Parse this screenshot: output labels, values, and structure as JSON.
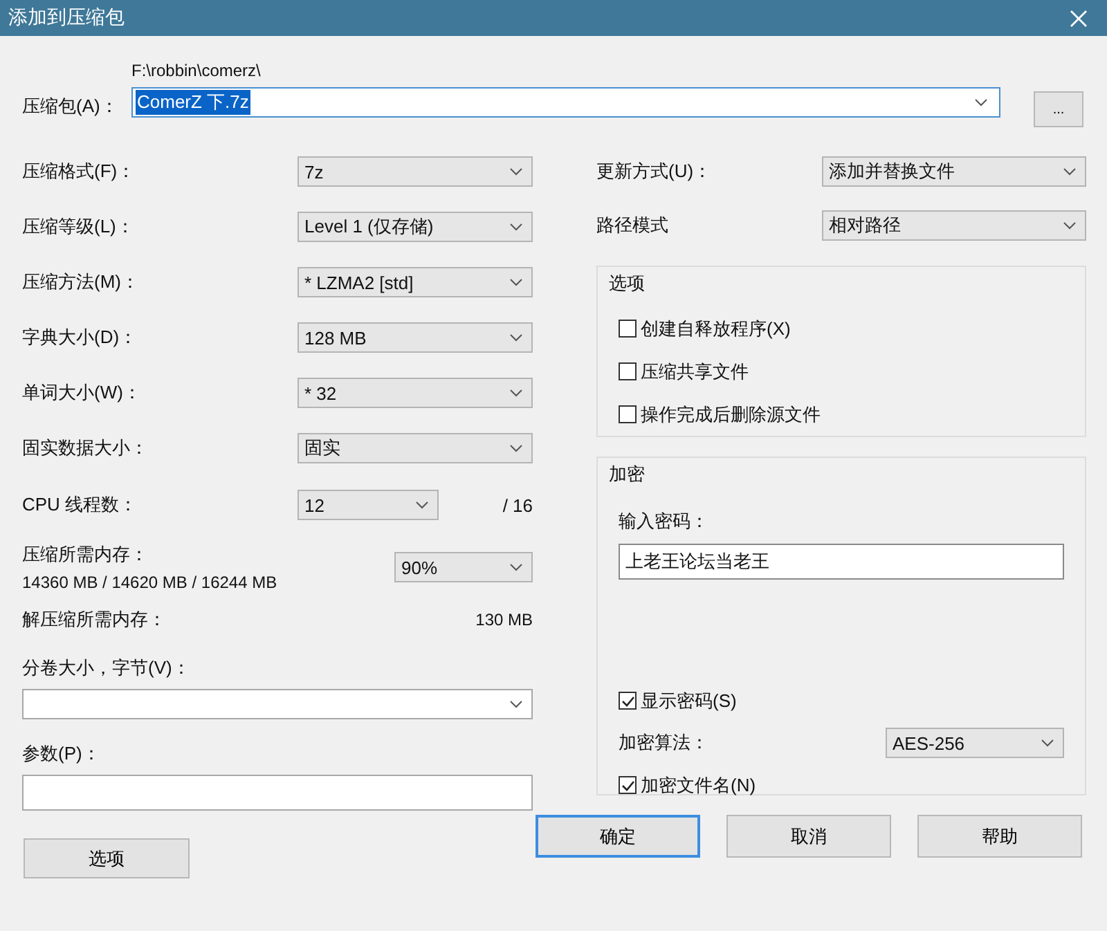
{
  "window": {
    "title": "添加到压缩包"
  },
  "archive": {
    "label": "压缩包(A)：",
    "path": "F:\\robbin\\comerz\\",
    "value": "ComerZ 下.7z",
    "text_selected": true
  },
  "browse_button": "...",
  "left_options": [
    {
      "label": "压缩格式(F)：",
      "value": "7z"
    },
    {
      "label": "压缩等级(L)：",
      "value": "Level 1 (仅存储)"
    },
    {
      "label": "压缩方法(M)：",
      "value": "* LZMA2 [std]"
    },
    {
      "label": "字典大小(D)：",
      "value": "128 MB"
    },
    {
      "label": "单词大小(W)：",
      "value": "* 32"
    },
    {
      "label": "固实数据大小：",
      "value": "固实"
    }
  ],
  "cpu": {
    "label": "CPU 线程数：",
    "value": "12",
    "max": "/ 16"
  },
  "memory": {
    "label": "压缩所需内存：",
    "usage": "14360 MB / 14620 MB / 16244 MB",
    "value": "90%"
  },
  "decompress_memory": {
    "label": "解压缩所需内存：",
    "value": "130 MB"
  },
  "volume": {
    "label": "分卷大小，字节(V)："
  },
  "params": {
    "label": "参数(P)："
  },
  "options_button": "选项",
  "right_options": [
    {
      "label": "更新方式(U)：",
      "value": "添加并替换文件"
    },
    {
      "label": "路径模式",
      "value": "相对路径"
    }
  ],
  "options_group": {
    "title": "选项",
    "checkboxes": [
      {
        "label": "创建自释放程序(X)",
        "checked": false
      },
      {
        "label": "压缩共享文件",
        "checked": false
      },
      {
        "label": "操作完成后删除源文件",
        "checked": false
      }
    ]
  },
  "encryption": {
    "title": "加密",
    "password_label": "输入密码：",
    "password": "上老王论坛当老王",
    "show_password": {
      "label": "显示密码(S)",
      "checked": true
    },
    "method_label": "加密算法：",
    "method": "AES-256",
    "encrypt_names": {
      "label": "加密文件名(N)",
      "checked": true
    }
  },
  "buttons": [
    {
      "label": "确定",
      "default": true
    },
    {
      "label": "取消",
      "default": false
    },
    {
      "label": "帮助",
      "default": false
    }
  ]
}
